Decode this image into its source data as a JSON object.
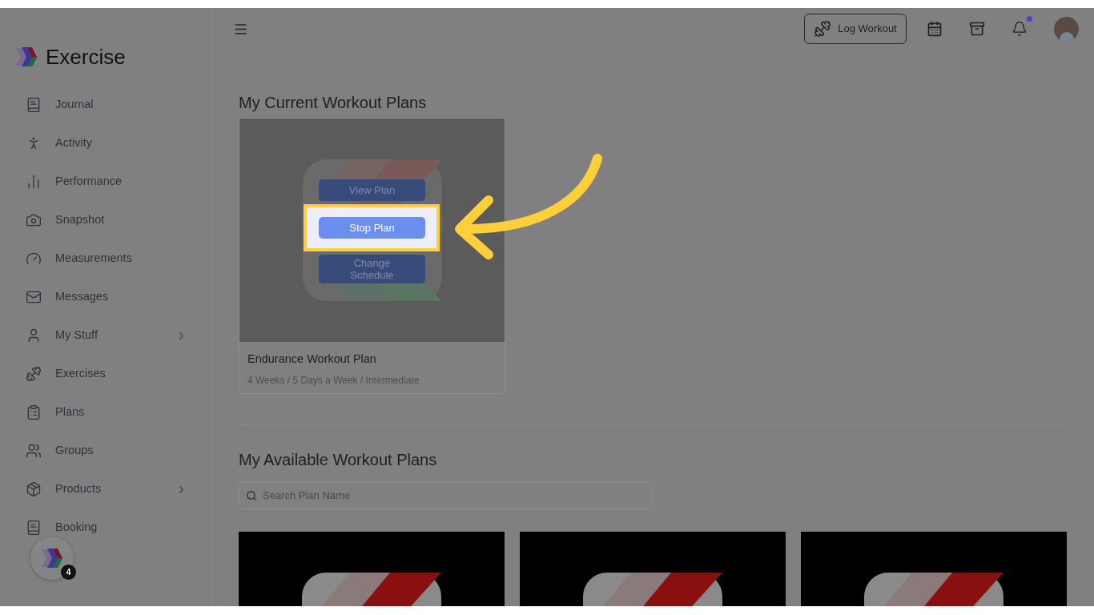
{
  "app": {
    "name": "Exercise"
  },
  "sidebar": {
    "items": [
      {
        "label": "Journal",
        "expandable": false
      },
      {
        "label": "Activity",
        "expandable": false
      },
      {
        "label": "Performance",
        "expandable": false
      },
      {
        "label": "Snapshot",
        "expandable": false
      },
      {
        "label": "Measurements",
        "expandable": false
      },
      {
        "label": "Messages",
        "expandable": false
      },
      {
        "label": "My Stuff",
        "expandable": true
      },
      {
        "label": "Exercises",
        "expandable": false
      },
      {
        "label": "Plans",
        "expandable": false
      },
      {
        "label": "Groups",
        "expandable": false
      },
      {
        "label": "Products",
        "expandable": true
      },
      {
        "label": "Booking",
        "expandable": false
      }
    ],
    "floating_badge": {
      "count": "4"
    }
  },
  "header": {
    "log_workout": "Log Workout",
    "notifications": {
      "unread": true
    }
  },
  "current_plans": {
    "title": "My Current Workout Plans",
    "plans": [
      {
        "name": "Endurance Workout Plan",
        "details": "4 Weeks / 5 Days a Week / Intermediate",
        "actions": [
          {
            "label": "View Plan",
            "highlighted": false
          },
          {
            "label": "Stop Plan",
            "highlighted": true
          },
          {
            "label": "Change Schedule",
            "highlighted": false
          }
        ]
      }
    ]
  },
  "available_plans": {
    "title": "My Available Workout Plans",
    "search": {
      "placeholder": "Search Plan Name"
    },
    "plans": [
      {
        "kind": "thumbnail"
      },
      {
        "kind": "thumbnail"
      },
      {
        "kind": "thumbnail"
      }
    ]
  }
}
